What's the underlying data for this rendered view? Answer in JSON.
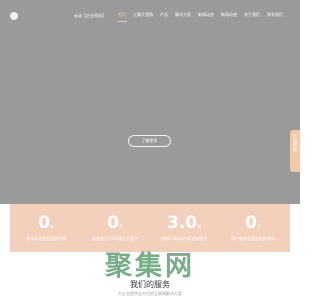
{
  "colors": {
    "hero_background": "#9a9a9a",
    "accent": "#f0c6a2",
    "stats_background": "#f3d0bc",
    "side_tab": "#f3c9a8",
    "watermark": "#1e7837"
  },
  "header": {
    "logo_text": "",
    "brand_tag": "云站【企业网站】",
    "menu": [
      {
        "label": "首页",
        "active": true
      },
      {
        "label": "江舞大堂购",
        "active": false
      },
      {
        "label": "产品",
        "active": false
      },
      {
        "label": "解决方案",
        "active": false
      },
      {
        "label": "新闻动态",
        "active": false
      },
      {
        "label": "新闻动态",
        "active": false
      },
      {
        "label": "关于我们",
        "active": false
      },
      {
        "label": "联系我们",
        "active": false
      }
    ]
  },
  "hero": {
    "cta_label": "了解更多"
  },
  "side_tab": {
    "icon": "chat-icon",
    "label": "在线客服"
  },
  "stats": [
    {
      "value": "0",
      "unit": "年",
      "label": "多年从业经验深耕积累"
    },
    {
      "value": "0",
      "unit": "家",
      "label": "服务超过1500家企业客户"
    },
    {
      "value": "3.0",
      "unit": "版",
      "label": "系统3.0版本持续更新迭代"
    },
    {
      "value": "0",
      "unit": "个",
      "label": "用户遍布全国各地区城市"
    }
  ],
  "watermark": {
    "text": "聚集网"
  },
  "services": {
    "title": "我们的服务",
    "subtitle": "为企业提供全方位的互联网解决方案"
  }
}
